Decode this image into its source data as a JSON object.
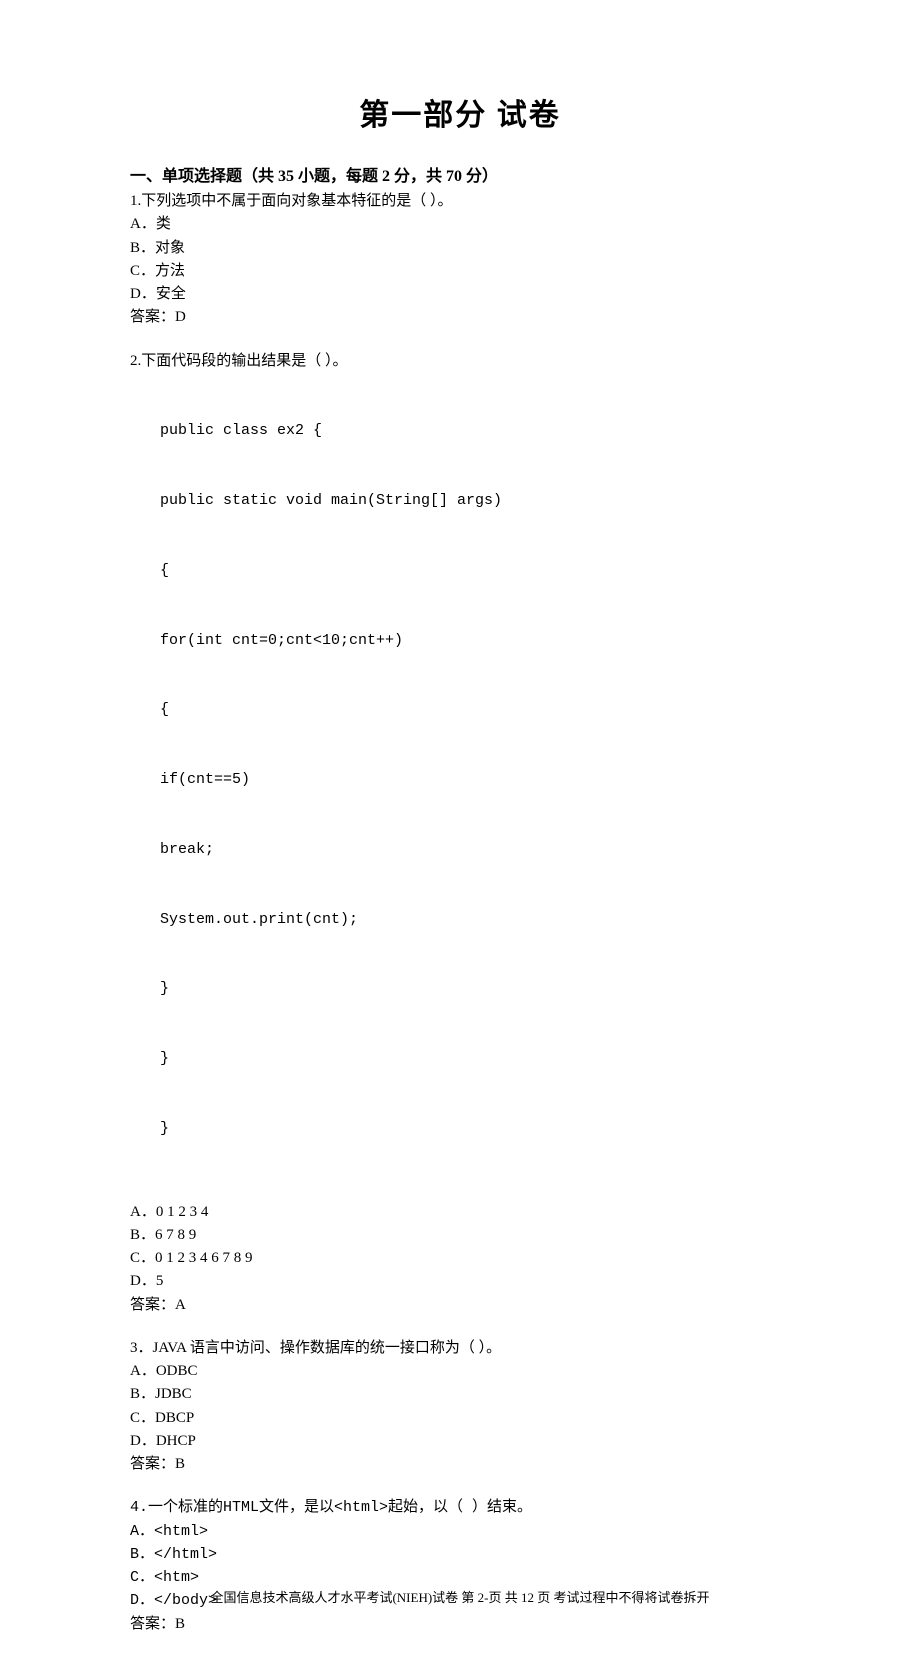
{
  "title": "第一部分 试卷",
  "section_header": "一、单项选择题（共 35 小题，每题 2 分，共 70 分）",
  "questions": [
    {
      "stem": "1.下列选项中不属于面向对象基本特征的是（ ）。",
      "options": [
        "A．类",
        "B．对象",
        "C．方法",
        "D．安全"
      ],
      "answer": "答案：D"
    },
    {
      "stem": "2.下面代码段的输出结果是（ ）。",
      "code": [
        "public class ex2 {",
        "public static void main(String[] args)",
        "{",
        "for(int cnt=0;cnt<10;cnt++)",
        "{",
        "if(cnt==5)",
        "break;",
        "System.out.print(cnt);",
        "}",
        "}",
        "}"
      ],
      "options": [
        "A．0 1 2 3 4",
        "B．6 7 8 9",
        "C．0 1 2 3 4 6 7 8 9",
        "D．5"
      ],
      "answer": "答案：A"
    },
    {
      "stem": "3．JAVA 语言中访问、操作数据库的统一接口称为（ ）。",
      "options": [
        "A．ODBC",
        "B．JDBC",
        "C．DBCP",
        "D．DHCP"
      ],
      "answer": "答案：B"
    },
    {
      "stem": "4.一个标准的HTML文件，是以<html>起始，以（ ）结束。",
      "options": [
        "A．<html>",
        "B．</html>",
        "C．<htm>",
        "D．</body>"
      ],
      "answer": "答案：B"
    }
  ],
  "footer": "全国信息技术高级人才水平考试(NIEH)试卷 第 2-页 共 12 页 考试过程中不得将试卷拆开"
}
